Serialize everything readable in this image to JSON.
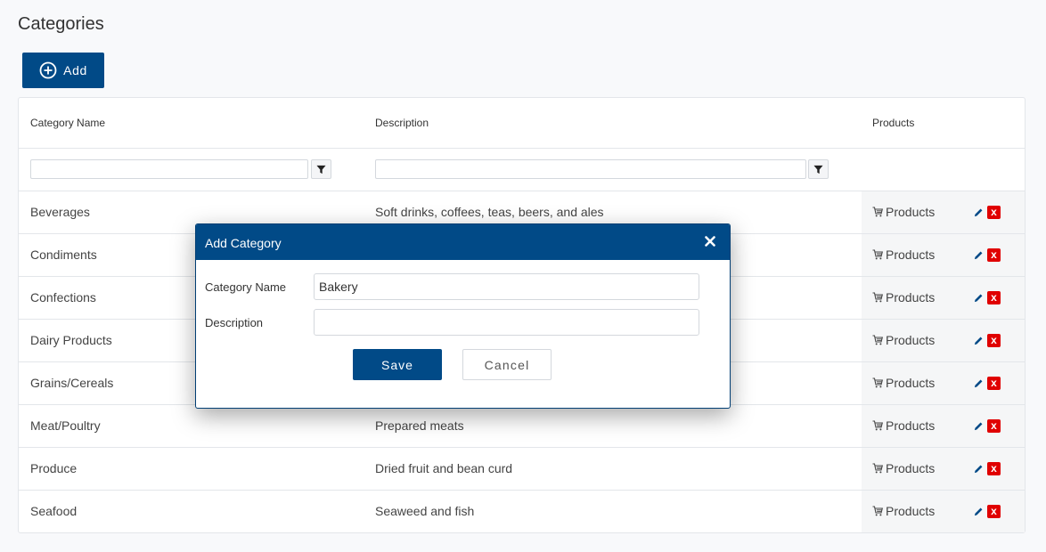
{
  "page": {
    "title": "Categories"
  },
  "toolbar": {
    "add_label": "Add"
  },
  "grid": {
    "columns": [
      "Category Name",
      "Description",
      "Products"
    ],
    "filters": {
      "name_value": "",
      "description_value": ""
    },
    "rows": [
      {
        "name": "Beverages",
        "description": "Soft drinks, coffees, teas, beers, and ales",
        "products_label": "Products"
      },
      {
        "name": "Condiments",
        "description": "",
        "products_label": "Products"
      },
      {
        "name": "Confections",
        "description": "",
        "products_label": "Products"
      },
      {
        "name": "Dairy Products",
        "description": "",
        "products_label": "Products"
      },
      {
        "name": "Grains/Cereals",
        "description": "",
        "products_label": "Products"
      },
      {
        "name": "Meat/Poultry",
        "description": "Prepared meats",
        "products_label": "Products"
      },
      {
        "name": "Produce",
        "description": "Dried fruit and bean curd",
        "products_label": "Products"
      },
      {
        "name": "Seafood",
        "description": "Seaweed and fish",
        "products_label": "Products"
      }
    ],
    "delete_glyph": "x"
  },
  "modal": {
    "title": "Add Category",
    "category_name_label": "Category Name",
    "category_name_value": "Bakery",
    "description_label": "Description",
    "description_value": "",
    "save_label": "Save",
    "cancel_label": "Cancel"
  },
  "colors": {
    "primary": "#014a87",
    "danger": "#e00000",
    "background": "#f8f9fb"
  },
  "icons": [
    "plus-circle-icon",
    "filter-icon",
    "cart-icon",
    "pencil-icon",
    "delete-icon",
    "close-icon"
  ]
}
